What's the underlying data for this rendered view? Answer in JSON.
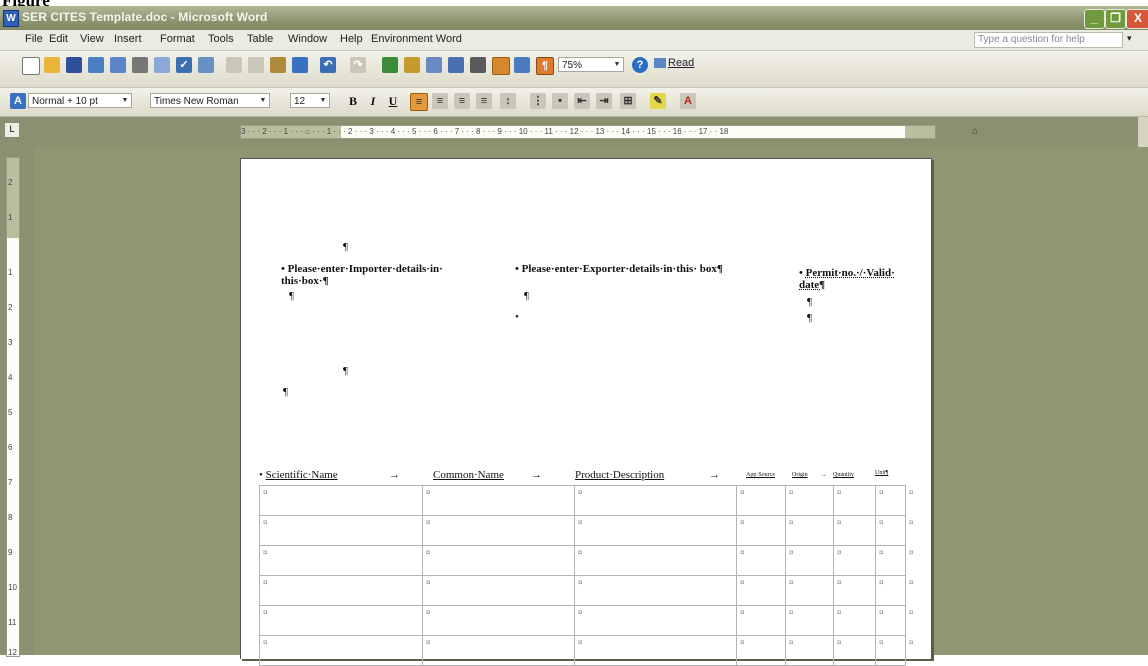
{
  "figure_label": "Figure",
  "window": {
    "title": "SER CITES Template.doc - Microsoft Word",
    "icon_glyph": "W",
    "minimize": "_",
    "restore": "❐",
    "close": "X"
  },
  "menu": {
    "items": [
      "File",
      "Edit",
      "View",
      "Insert",
      "Format",
      "Tools",
      "Table",
      "Window",
      "Help",
      "Environment Word"
    ],
    "help_placeholder": "Type a question for help"
  },
  "toolbar": {
    "zoom": "75%",
    "read_label": "Read",
    "style": "Normal + 10 pt",
    "font": "Times New Roman",
    "size": "12",
    "bold": "B",
    "italic": "I",
    "underline": "U",
    "para_mark": "¶"
  },
  "ruler": {
    "horizontal_text": "3 · · · 2 · · · 1 · · · ⌂ · · · 1 · · · 2 · · · 3 · · · 4 · · · 5 · · · 6 · · · 7 · · · 8 · · · 9 · · · 10 · · · 11 · · · 12 · · · 13 · · · 14 · · · 15 · · · 16 · · · 17 · · 18",
    "vertical_marks": [
      "2",
      "1",
      "·",
      "1",
      "2",
      "3",
      "4",
      "5",
      "6",
      "7",
      "8",
      "9",
      "10",
      "11",
      "12",
      "13"
    ]
  },
  "document": {
    "para1": "¶",
    "importer": "Please·enter·Importer·details·in· this·box·¶",
    "exporter": "Please·enter·Exporter·details·in·this· box¶",
    "permit": "Permit·no.·/·Valid· date¶",
    "pilcrow": "¶",
    "headers": [
      "Scientific·Name",
      "Common·Name",
      "Product·Description",
      "App·Source",
      "Origin",
      "Quantity",
      "Unit¶"
    ],
    "arrow": "→",
    "cell_mark": "¤",
    "row_count": 6
  }
}
